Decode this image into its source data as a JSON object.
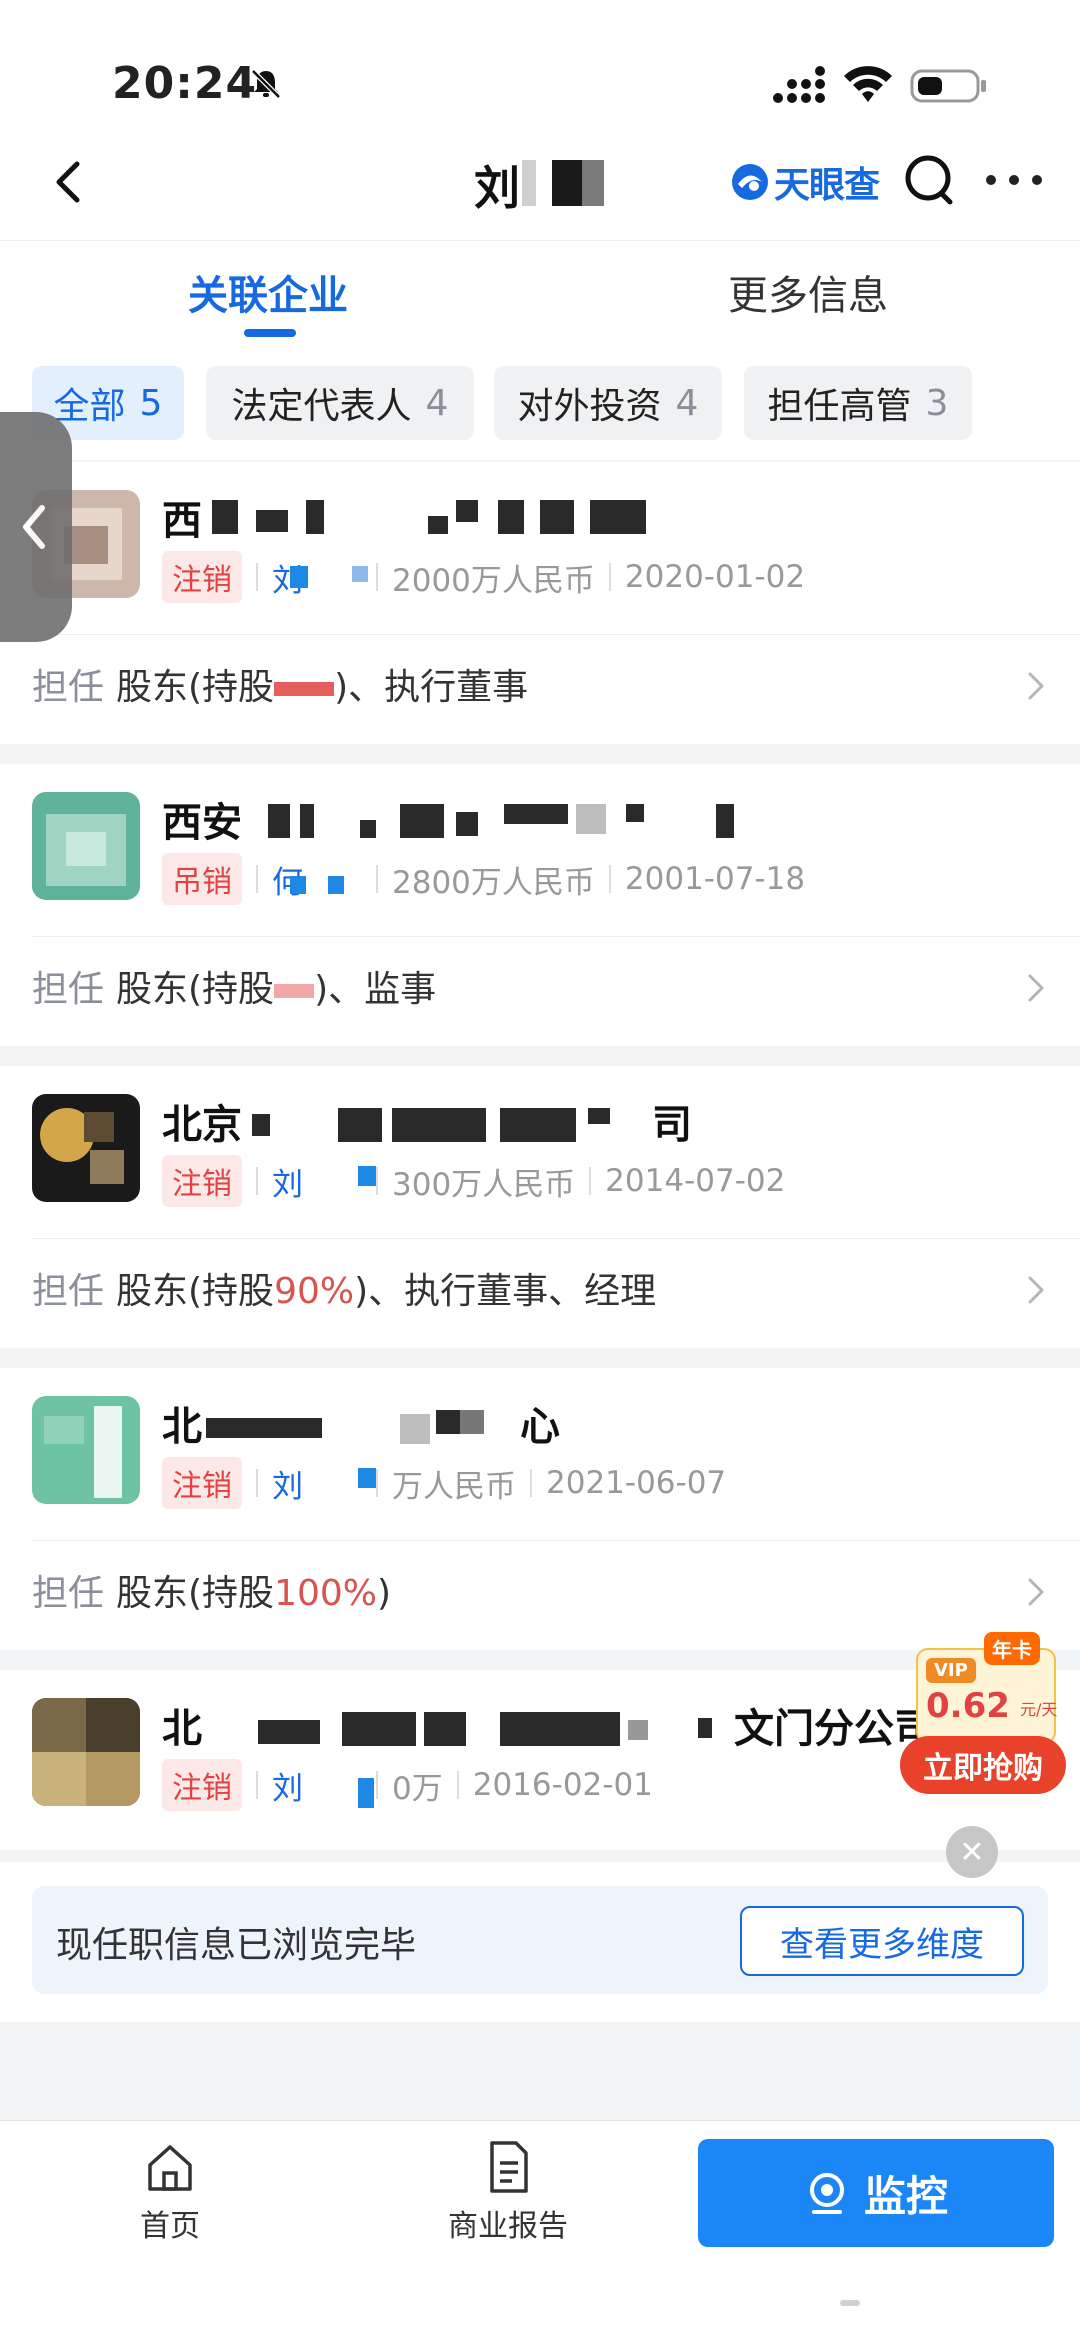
{
  "status_bar": {
    "time": "20:24"
  },
  "header": {
    "title_char": "刘",
    "brand": "天眼查"
  },
  "tabs": [
    {
      "label": "关联企业",
      "active": true
    },
    {
      "label": "更多信息",
      "active": false
    }
  ],
  "filters": [
    {
      "label": "全部",
      "count": "5",
      "active": true
    },
    {
      "label": "法定代表人",
      "count": "4",
      "active": false
    },
    {
      "label": "对外投资",
      "count": "4",
      "active": false
    },
    {
      "label": "担任高管",
      "count": "3",
      "active": false
    }
  ],
  "companies": [
    {
      "name": "西",
      "status": "注销",
      "rep": "刘",
      "capital": "2000万人民币",
      "date": "2020-01-02",
      "role_label": "担任",
      "role_pre": "股东(持股",
      "role_pct": "",
      "role_post": ")、执行董事"
    },
    {
      "name": "西安",
      "status": "吊销",
      "rep": "何",
      "capital": "2800万人民币",
      "date": "2001-07-18",
      "role_label": "担任",
      "role_pre": "股东(持股",
      "role_pct": "",
      "role_post": ")、监事"
    },
    {
      "name": "北京",
      "name_tail": "司",
      "status": "注销",
      "rep": "刘",
      "capital": "300万人民币",
      "date": "2014-07-02",
      "role_label": "担任",
      "role_pre": "股东(持股",
      "role_pct": "90%",
      "role_post": ")、执行董事、经理"
    },
    {
      "name": "北",
      "name_tail": "心",
      "status": "注销",
      "rep": "刘",
      "capital": "万人民币",
      "date": "2021-06-07",
      "role_label": "担任",
      "role_pre": "股东(持股",
      "role_pct": "100%",
      "role_post": ")"
    },
    {
      "name": "北",
      "name_tail": "文门分公司",
      "status": "注销",
      "rep": "刘",
      "capital": "0万",
      "date": "2016-02-01"
    }
  ],
  "end_notice": {
    "text": "现任职信息已浏览完毕",
    "button": "查看更多维度"
  },
  "promo": {
    "badge": "VIP",
    "tag": "年卡",
    "price": "0.62",
    "unit": "元/天",
    "cta": "立即抢购"
  },
  "bottom_nav": {
    "home": "首页",
    "report": "商业报告",
    "monitor": "监控"
  },
  "colors": {
    "accent": "#1769e0",
    "danger": "#e14242",
    "monitor_btn": "#1b86f5"
  }
}
